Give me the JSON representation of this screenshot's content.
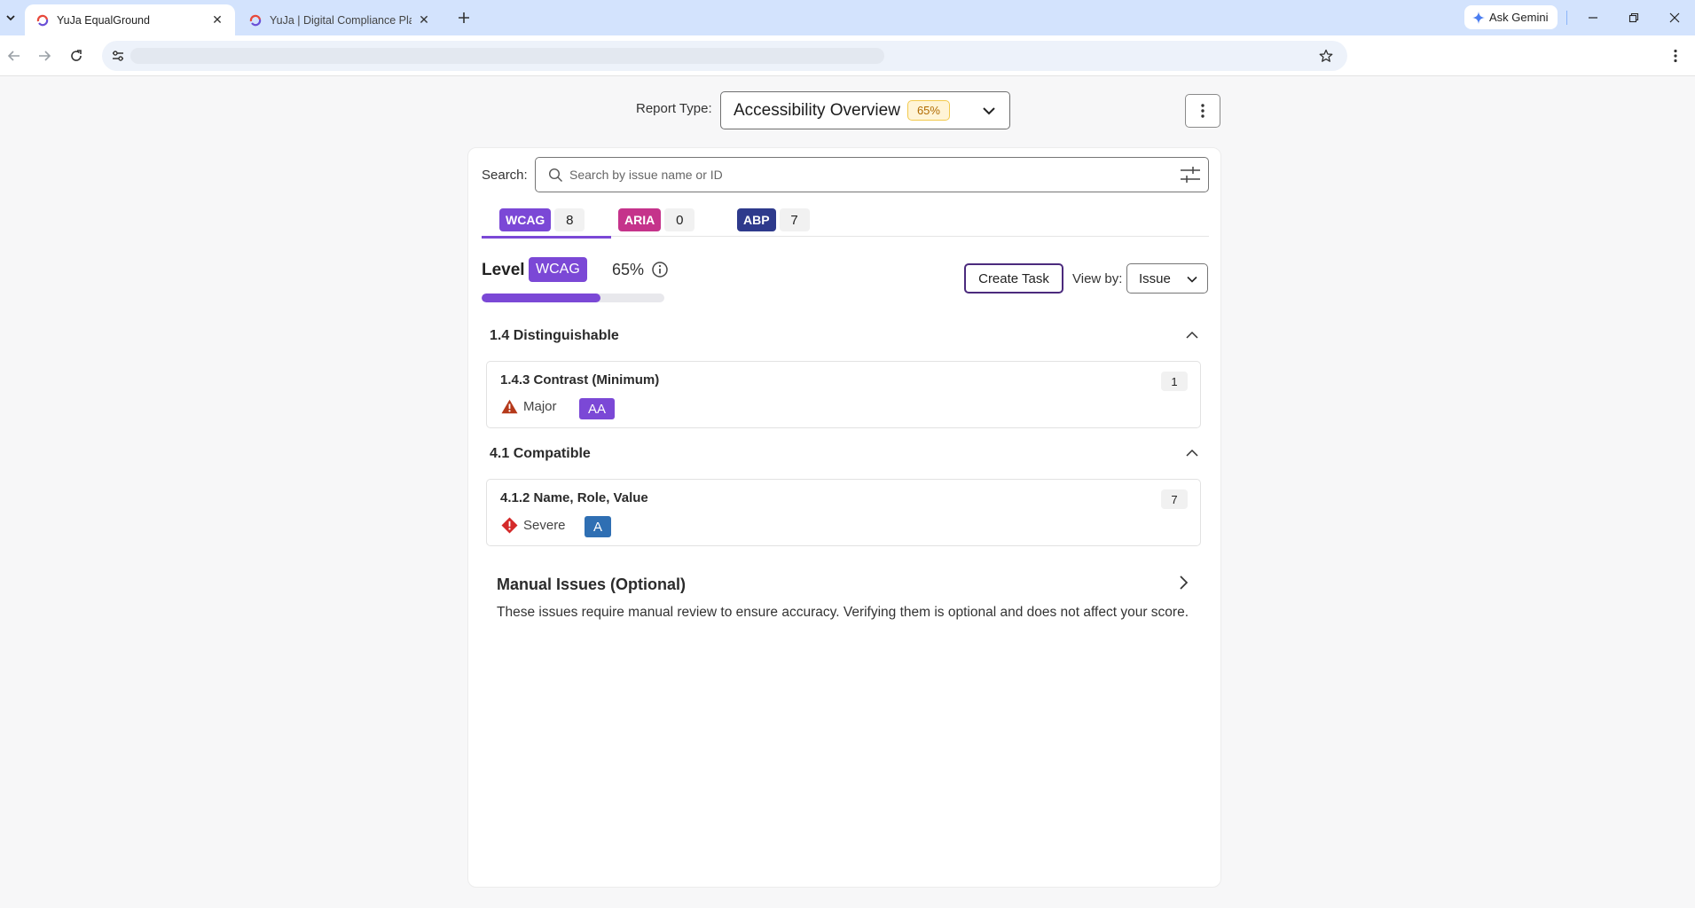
{
  "browser": {
    "tabs": [
      {
        "title": "YuJa EqualGround",
        "active": true
      },
      {
        "title": "YuJa | Digital Compliance Platfo",
        "active": false
      }
    ],
    "gemini_label": "Ask Gemini",
    "url": ""
  },
  "header": {
    "report_type_label": "Report Type:",
    "report_name": "Accessibility Overview",
    "report_score": "65%"
  },
  "search": {
    "label": "Search:",
    "placeholder": "Search by issue name or ID",
    "value": ""
  },
  "standards_tabs": [
    {
      "label": "WCAG",
      "count": "8",
      "color": "#7b48d6",
      "selected": true
    },
    {
      "label": "ARIA",
      "count": "0",
      "color": "#c5338b",
      "selected": false
    },
    {
      "label": "ABP",
      "count": "7",
      "color": "#2e3a8c",
      "selected": false
    }
  ],
  "level": {
    "label": "Level",
    "badge": "WCAG",
    "percent": "65%",
    "progress": 0.65
  },
  "actions": {
    "create_task": "Create Task",
    "view_by_label": "View by:",
    "view_by_value": "Issue"
  },
  "groups": [
    {
      "title": "1.4 Distinguishable",
      "issues": [
        {
          "title": "1.4.3 Contrast (Minimum)",
          "count": "1",
          "severity": "Major",
          "level": "AA",
          "level_color": "#7b48d6",
          "severity_icon": "warning-triangle-icon"
        }
      ]
    },
    {
      "title": "4.1 Compatible",
      "issues": [
        {
          "title": "4.1.2 Name, Role, Value",
          "count": "7",
          "severity": "Severe",
          "level": "A",
          "level_color": "#2f6fb3",
          "severity_icon": "severe-diamond-icon"
        }
      ]
    }
  ],
  "manual": {
    "title": "Manual Issues (Optional)",
    "description": "These issues require manual review to ensure accuracy. Verifying them is optional and does not affect your score."
  },
  "colors": {
    "accent": "#7b48d6",
    "major": "#b5391a",
    "severe": "#d42a2a"
  }
}
